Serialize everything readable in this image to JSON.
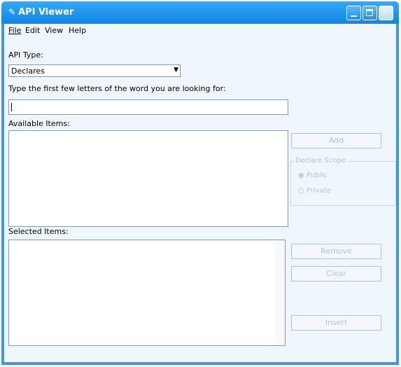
{
  "window": {
    "title": "API Viewer"
  },
  "menu": {
    "file": "File",
    "edit": "Edit",
    "view": "View",
    "help": "Help"
  },
  "api_type": {
    "label": "API Type:",
    "selected": "Declares"
  },
  "search": {
    "label": "Type the first few letters of the word you are looking for:",
    "value": ""
  },
  "available": {
    "label": "Available Items:"
  },
  "selected_items": {
    "label": "Selected Items:"
  },
  "buttons": {
    "add": "Add",
    "remove": "Remove",
    "clear": "Clear",
    "insert": "Insert"
  },
  "declare_scope": {
    "title": "Declare Scope",
    "public": "Public",
    "private": "Private"
  },
  "colors": {
    "titlebar": "#0f86e8",
    "client": "#f0f6fd",
    "disabled_text": "#b0c4d8"
  }
}
